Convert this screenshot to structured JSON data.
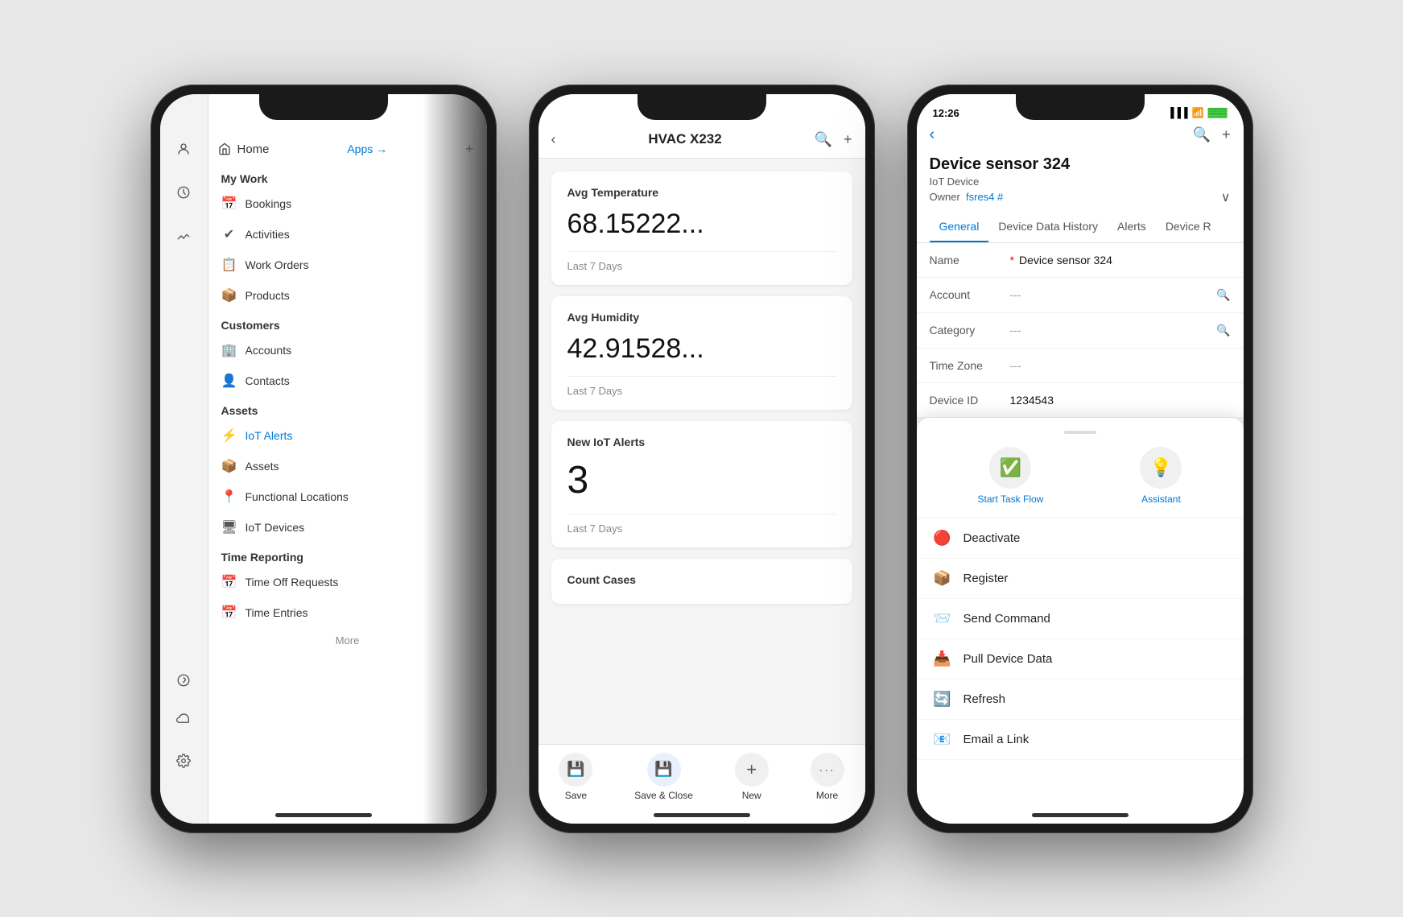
{
  "phone1": {
    "sidebar_icons": [
      "user",
      "clock",
      "chart"
    ],
    "home_label": "Home",
    "apps_label": "Apps →",
    "sections": [
      {
        "title": "My Work",
        "items": [
          {
            "label": "Bookings",
            "icon": "📅"
          },
          {
            "label": "Activities",
            "icon": "✔"
          },
          {
            "label": "Work Orders",
            "icon": "📋"
          },
          {
            "label": "Products",
            "icon": "📦"
          }
        ]
      },
      {
        "title": "Customers",
        "items": [
          {
            "label": "Accounts",
            "icon": "🏢"
          },
          {
            "label": "Contacts",
            "icon": "👤"
          }
        ]
      },
      {
        "title": "Assets",
        "items": [
          {
            "label": "IoT Alerts",
            "icon": "⚡",
            "active": true
          },
          {
            "label": "Assets",
            "icon": "📦"
          },
          {
            "label": "Functional Locations",
            "icon": "📍"
          },
          {
            "label": "IoT Devices",
            "icon": "🖥"
          }
        ]
      },
      {
        "title": "Time Reporting",
        "items": [
          {
            "label": "Time Off Requests",
            "icon": "📅"
          },
          {
            "label": "Time Entries",
            "icon": "📅"
          }
        ]
      }
    ],
    "more_label": "More"
  },
  "phone2": {
    "title": "HVAC X232",
    "metrics": [
      {
        "label": "Avg Temperature",
        "value": "68.15222...",
        "sub": "Last 7 Days"
      },
      {
        "label": "Avg Humidity",
        "value": "42.91528...",
        "sub": "Last 7 Days"
      },
      {
        "label": "New IoT Alerts",
        "value": "3",
        "sub": "Last 7 Days"
      },
      {
        "label": "Count Cases",
        "value": ""
      }
    ],
    "footer_buttons": [
      {
        "label": "Save",
        "icon": "💾"
      },
      {
        "label": "Save & Close",
        "icon": "💾"
      },
      {
        "label": "New",
        "icon": "+"
      },
      {
        "label": "More",
        "icon": "···"
      }
    ]
  },
  "phone3": {
    "status_time": "12:26",
    "device_name": "Device sensor 324",
    "device_type": "IoT Device",
    "owner_label": "Owner",
    "owner_value": "fsres4 #",
    "tabs": [
      "General",
      "Device Data History",
      "Alerts",
      "Device R"
    ],
    "fields": [
      {
        "name": "Name",
        "required": true,
        "value": "Device sensor 324",
        "has_search": false
      },
      {
        "name": "Account",
        "required": false,
        "value": "---",
        "has_search": true
      },
      {
        "name": "Category",
        "required": false,
        "value": "---",
        "has_search": true
      },
      {
        "name": "Time Zone",
        "required": false,
        "value": "---",
        "has_search": false
      },
      {
        "name": "Device ID",
        "required": false,
        "value": "1234543",
        "has_search": false
      }
    ],
    "quick_actions": [
      {
        "label": "Start Task Flow",
        "icon": "✔"
      },
      {
        "label": "Assistant",
        "icon": "💡"
      }
    ],
    "action_items": [
      {
        "label": "Deactivate",
        "icon": "🔴"
      },
      {
        "label": "Register",
        "icon": "📦"
      },
      {
        "label": "Send Command",
        "icon": "📨"
      },
      {
        "label": "Pull Device Data",
        "icon": "📥"
      },
      {
        "label": "Refresh",
        "icon": "🔄"
      },
      {
        "label": "Email a Link",
        "icon": "📧"
      }
    ]
  }
}
